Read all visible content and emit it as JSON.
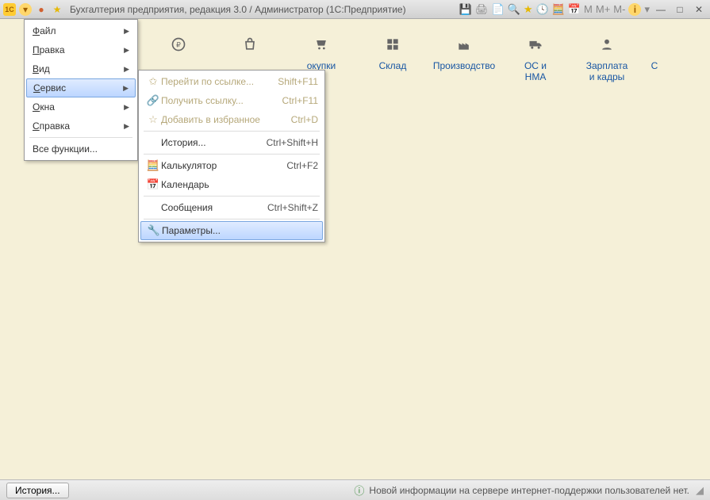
{
  "title": "Бухгалтерия предприятия, редакция 3.0 / Администратор  (1С:Предприятие)",
  "titlebar_memory": {
    "m": "M",
    "mplus": "M+",
    "mminus": "M-"
  },
  "sections": [
    {
      "icon": "ruble",
      "label1": "",
      "label2": ""
    },
    {
      "icon": "bag",
      "label1": "",
      "label2": ""
    },
    {
      "icon": "cart",
      "label1": "окупки",
      "label2": ""
    },
    {
      "icon": "grid",
      "label1": "Склад",
      "label2": ""
    },
    {
      "icon": "factory",
      "label1": "Производство",
      "label2": ""
    },
    {
      "icon": "truck",
      "label1": "ОС и",
      "label2": "НМА"
    },
    {
      "icon": "person",
      "label1": "Зарплата",
      "label2": "и кадры"
    },
    {
      "icon": "more",
      "label1": "С",
      "label2": ""
    }
  ],
  "menu": [
    {
      "label": "Файл",
      "arrow": true
    },
    {
      "label": "Правка",
      "arrow": true
    },
    {
      "label": "Вид",
      "arrow": true
    },
    {
      "label": "Сервис",
      "arrow": true,
      "active": true
    },
    {
      "label": "Окна",
      "arrow": true
    },
    {
      "label": "Справка",
      "arrow": true
    },
    {
      "sep": true
    },
    {
      "label": "Все функции...",
      "arrow": false
    }
  ],
  "submenu": [
    {
      "icon": "star-go",
      "label": "Перейти по ссылке...",
      "shortcut": "Shift+F11",
      "disabled": true
    },
    {
      "icon": "link",
      "label": "Получить ссылку...",
      "shortcut": "Ctrl+F11",
      "disabled": true
    },
    {
      "icon": "star",
      "label": "Добавить в избранное",
      "shortcut": "Ctrl+D",
      "disabled": true
    },
    {
      "sep": true
    },
    {
      "icon": "",
      "label": "История...",
      "shortcut": "Ctrl+Shift+H",
      "disabled": false
    },
    {
      "sep": true
    },
    {
      "icon": "calc",
      "label": "Калькулятор",
      "shortcut": "Ctrl+F2",
      "disabled": false
    },
    {
      "icon": "calendar",
      "label": "Календарь",
      "shortcut": "",
      "disabled": false
    },
    {
      "sep": true
    },
    {
      "icon": "",
      "label": "Сообщения",
      "shortcut": "Ctrl+Shift+Z",
      "disabled": false
    },
    {
      "sep": true
    },
    {
      "icon": "wrench",
      "label": "Параметры...",
      "shortcut": "",
      "disabled": false,
      "highlight": true
    }
  ],
  "statusbar": {
    "history_button": "История...",
    "message": "Новой информации на сервере интернет-поддержки пользователей нет."
  }
}
